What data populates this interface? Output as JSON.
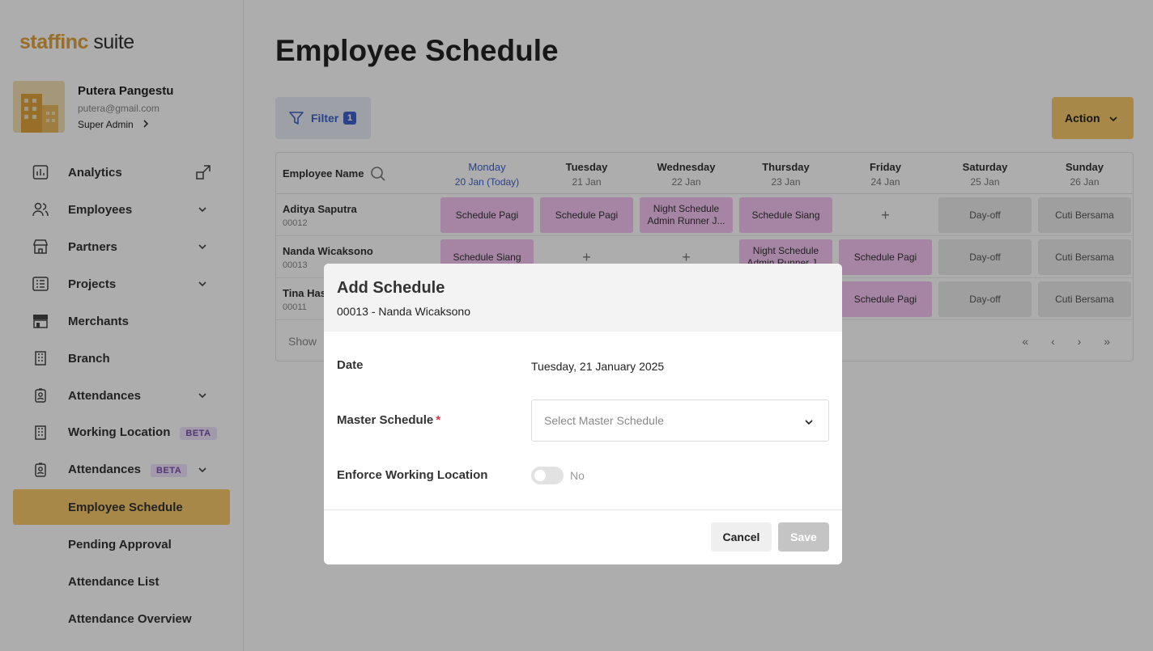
{
  "app": {
    "logo_part1": "staff",
    "logo_part2": "inc",
    "logo_part3": " suite",
    "brand_color": "#e0a33c"
  },
  "profile": {
    "name": "Putera Pangestu",
    "email": "putera@gmail.com",
    "role": "Super Admin"
  },
  "sidebar": {
    "items": [
      {
        "label": "Analytics",
        "icon": "chart-icon"
      },
      {
        "label": "Employees",
        "icon": "users-icon"
      },
      {
        "label": "Partners",
        "icon": "store-icon"
      },
      {
        "label": "Projects",
        "icon": "list-icon"
      },
      {
        "label": "Merchants",
        "icon": "merchant-icon"
      },
      {
        "label": "Branch",
        "icon": "building-icon"
      },
      {
        "label": "Attendances",
        "icon": "badge-icon"
      },
      {
        "label": "Working Location",
        "icon": "building-icon",
        "badge": "BETA"
      },
      {
        "label": "Attendances",
        "icon": "badge-icon",
        "badge": "BETA"
      }
    ],
    "subitems": [
      {
        "label": "Employee Schedule",
        "active": true
      },
      {
        "label": "Pending Approval"
      },
      {
        "label": "Attendance List"
      },
      {
        "label": "Attendance Overview"
      }
    ]
  },
  "main": {
    "title": "Employee Schedule",
    "filter_label": "Filter",
    "filter_count": "1",
    "action_label": "Action"
  },
  "table": {
    "name_header": "Employee Name",
    "days": [
      {
        "day": "Monday",
        "date": "20 Jan (Today)"
      },
      {
        "day": "Tuesday",
        "date": "21 Jan"
      },
      {
        "day": "Wednesday",
        "date": "22 Jan"
      },
      {
        "day": "Thursday",
        "date": "23 Jan"
      },
      {
        "day": "Friday",
        "date": "24 Jan"
      },
      {
        "day": "Saturday",
        "date": "25 Jan"
      },
      {
        "day": "Sunday",
        "date": "26 Jan"
      }
    ],
    "rows": [
      {
        "name": "Aditya Saputra",
        "id": "00012",
        "cells": [
          "Schedule Pagi",
          "Schedule Pagi",
          "Night Schedule Admin Runner J...",
          "Schedule Siang",
          "+",
          "Day-off",
          "Cuti Bersama"
        ]
      },
      {
        "name": "Nanda Wicaksono",
        "id": "00013",
        "cells": [
          "Schedule Siang",
          "+",
          "+",
          "Night Schedule Admin Runner J...",
          "Schedule Pagi",
          "Day-off",
          "Cuti Bersama"
        ]
      },
      {
        "name": "Tina Has",
        "id": "00011",
        "cells": [
          "",
          "",
          "",
          "",
          "Schedule Pagi",
          "Day-off",
          "Cuti Bersama"
        ]
      }
    ],
    "footer_show": "Show",
    "pager": "« ‹ › »"
  },
  "modal": {
    "title": "Add Schedule",
    "subtitle": "00013 - Nanda Wicaksono",
    "date_label": "Date",
    "date_value": "Tuesday, 21 January 2025",
    "master_label": "Master Schedule",
    "master_required": "*",
    "master_placeholder": "Select Master Schedule",
    "enforce_label": "Enforce Working Location",
    "enforce_value": "No",
    "cancel_label": "Cancel",
    "save_label": "Save"
  }
}
